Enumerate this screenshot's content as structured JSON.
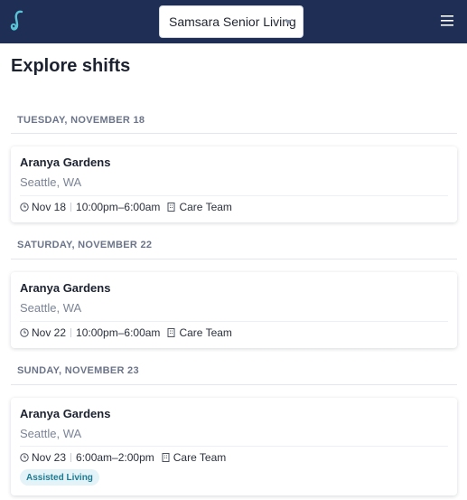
{
  "header": {
    "logo_icon": "hook-logo-icon",
    "organization": "Samsara Senior Living",
    "menu_icon": "hamburger-menu-icon"
  },
  "page": {
    "title": "Explore shifts"
  },
  "groups": [
    {
      "date_label": "TUESDAY, NOVEMBER 18",
      "shift": {
        "facility": "Aranya Gardens",
        "location": "Seattle, WA",
        "date": "Nov 18",
        "time": "10:00pm–6:00am",
        "team": "Care Team",
        "tag": ""
      }
    },
    {
      "date_label": "SATURDAY, NOVEMBER 22",
      "shift": {
        "facility": "Aranya Gardens",
        "location": "Seattle, WA",
        "date": "Nov 22",
        "time": "10:00pm–6:00am",
        "team": "Care Team",
        "tag": ""
      }
    },
    {
      "date_label": "SUNDAY, NOVEMBER 23",
      "shift": {
        "facility": "Aranya Gardens",
        "location": "Seattle, WA",
        "date": "Nov 23",
        "time": "6:00am–2:00pm",
        "team": "Care Team",
        "tag": "Assisted Living"
      }
    }
  ],
  "colors": {
    "header_bg": "#1e2e55",
    "logo": "#5bc3d6",
    "tag_bg": "#e4f3f7",
    "tag_text": "#1c7a93"
  }
}
